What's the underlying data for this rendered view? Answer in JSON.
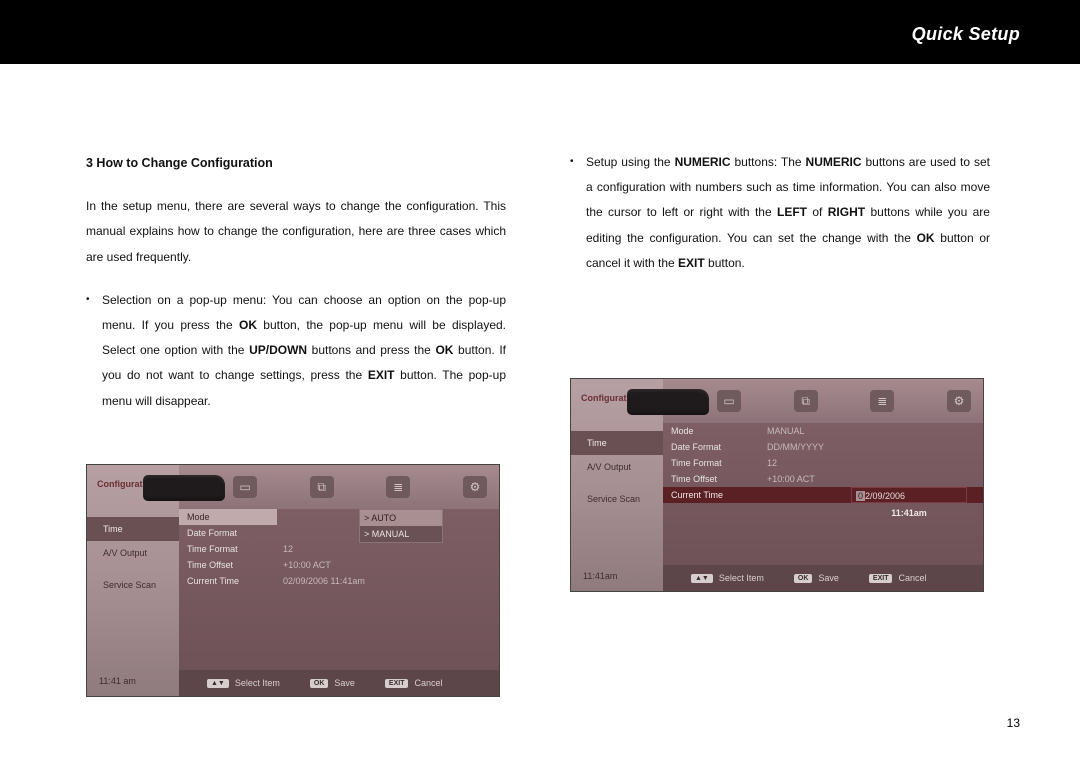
{
  "header": {
    "title": "Quick Setup"
  },
  "page_number": "13",
  "left": {
    "section_head": "3 How to Change Configuration",
    "intro": "In the setup menu, there are several ways to change the configuration. This manual explains how to change the configuration, here are three cases which are used frequently.",
    "bullet_pre": "Selection on a pop-up menu: You can choose an option on the pop-up menu. If you press the ",
    "bullet_ok1": "OK",
    "bullet_mid1": " button, the pop-up menu will be displayed. Select one option with the ",
    "bullet_updown": "UP/DOWN",
    "bullet_mid2": " buttons and press the ",
    "bullet_ok2": "OK",
    "bullet_mid3": " button. If you do not want to change settings, press the ",
    "bullet_exit": "EXIT",
    "bullet_post": " button. The pop-up menu will disappear."
  },
  "right": {
    "bullet_pre": "Setup using the ",
    "bullet_num1": "NUMERIC",
    "bullet_mid1": " buttons: The ",
    "bullet_num2": "NUMERIC",
    "bullet_mid2": " buttons are used to set a configuration with numbers such as time information. You can also move the cursor to left or right with the ",
    "bullet_left": "LEFT",
    "bullet_of": " of ",
    "bullet_right": "RIGHT",
    "bullet_mid3": " buttons while you are editing the configuration. You can set the change with the ",
    "bullet_ok": "OK",
    "bullet_mid4": " button or cancel it with the ",
    "bullet_exit": "EXIT",
    "bullet_post": " button."
  },
  "shot_left": {
    "title": "Configuration",
    "sidebar": [
      "Time",
      "A/V Output",
      "Service Scan"
    ],
    "selected_sidebar": 0,
    "clock": "11:41 am",
    "rows": {
      "mode_label": "Mode",
      "date_format_label": "Date Format",
      "date_format_value": "",
      "time_format_label": "Time Format",
      "time_format_value": "12",
      "time_offset_label": "Time Offset",
      "time_offset_value": "+10:00 ACT",
      "current_time_label": "Current Time",
      "current_time_value": "02/09/2006  11:41am"
    },
    "popup": {
      "auto": "> AUTO",
      "manual": "> MANUAL"
    },
    "hints": {
      "select": "Select Item",
      "save": "Save",
      "cancel": "Cancel",
      "kbd_arrows": "▲▼",
      "kbd_ok": "OK",
      "kbd_exit": "EXIT"
    }
  },
  "shot_right": {
    "title": "Configuration",
    "sidebar": [
      "Time",
      "A/V Output",
      "Service Scan"
    ],
    "selected_sidebar": 0,
    "clock": "11:41am",
    "rows": {
      "mode_label": "Mode",
      "mode_value": "MANUAL",
      "date_format_label": "Date Format",
      "date_format_value": "DD/MM/YYYY",
      "time_format_label": "Time Format",
      "time_format_value": "12",
      "time_offset_label": "Time Offset",
      "time_offset_value": "+10:00 ACT",
      "current_time_label": "Current Time",
      "current_time_value": ""
    },
    "cursor": {
      "first": "0",
      "rest": "2/09/2006"
    },
    "subtime": "11:41am",
    "hints": {
      "select": "Select Item",
      "save": "Save",
      "cancel": "Cancel",
      "kbd_arrows": "▲▼",
      "kbd_ok": "OK",
      "kbd_exit": "EXIT"
    }
  }
}
